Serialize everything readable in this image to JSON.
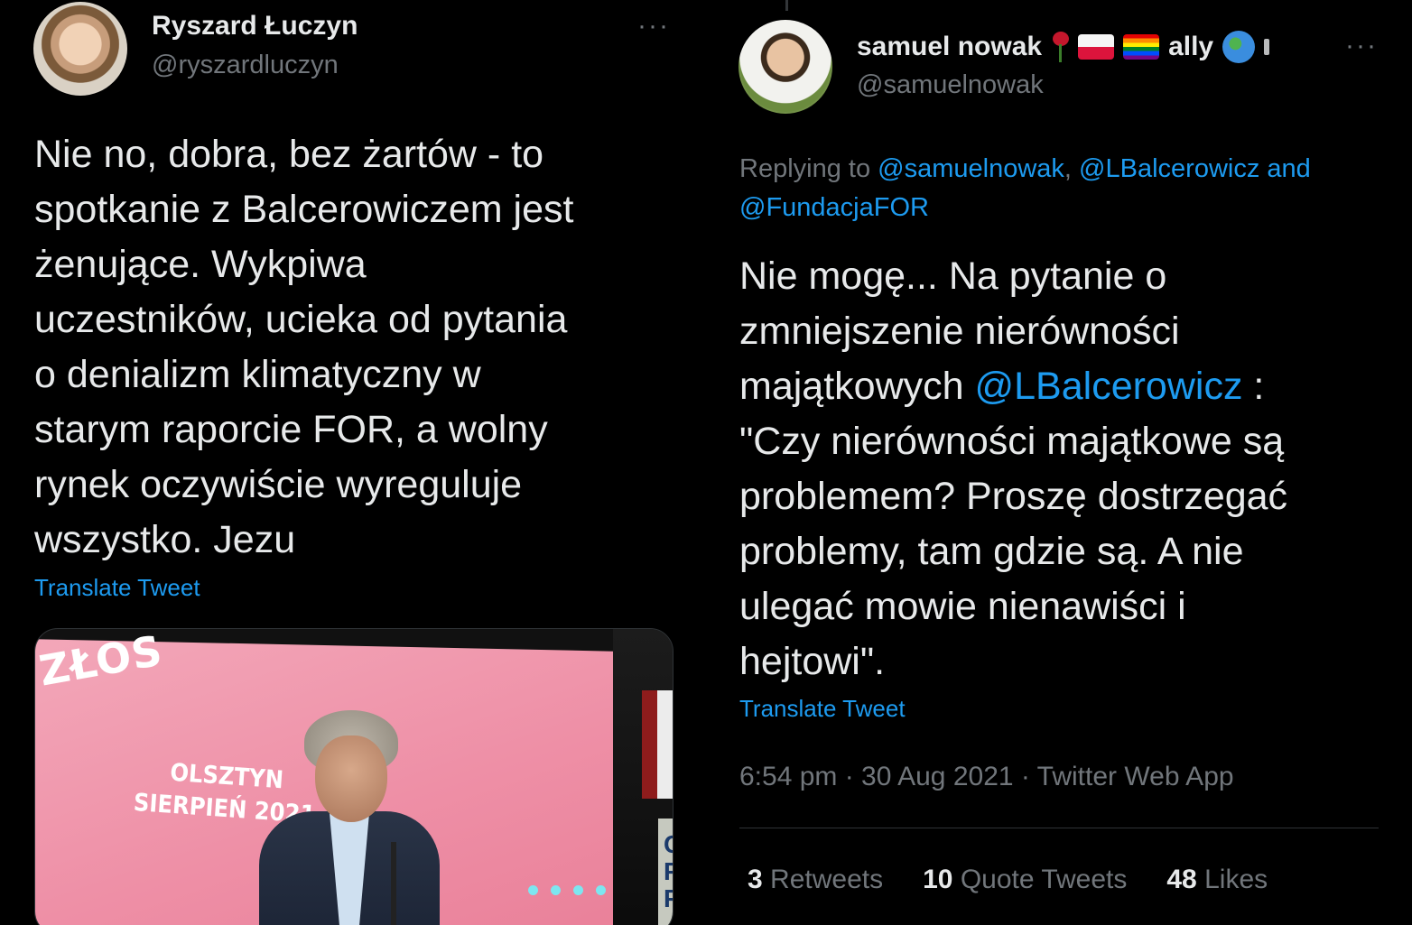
{
  "colors": {
    "background": "#000000",
    "text_primary": "#e7e9ea",
    "text_secondary": "#71767b",
    "link": "#1d9bf0",
    "divider": "#2f3336"
  },
  "left_tweet": {
    "author_name": "Ryszard Łuczyn",
    "author_handle": "@ryszardluczyn",
    "more_icon": "more-dots-icon",
    "more_label": "···",
    "text": "Nie no, dobra, bez żartów - to\nspotkanie z Balcerowiczem jest\nżenujące. Wykpiwa\nuczestników, ucieka od pytania\no denializm klimatyczny w\nstarym raporcie FOR, a wolny\nrynek oczywiście wyreguluje\nwszystko. Jezu",
    "translate_label": "Translate Tweet",
    "media": {
      "logo_text": "ZŁOS",
      "event_line1": "OLSZTYN",
      "event_line2": "SIERPIEŃ 2021",
      "sign_text": "CA\nPO\nPRZY"
    }
  },
  "right_tweet": {
    "author_name": "samuel nowak",
    "name_suffix": "ally",
    "name_emojis": [
      "rose-emoji",
      "poland-flag-emoji",
      "rainbow-flag-emoji",
      "globe-emoji"
    ],
    "author_handle": "@samuelnowak",
    "more_icon": "more-dots-icon",
    "more_label": "···",
    "replying_prefix": "Replying to ",
    "replying_mentions": [
      "@samuelnowak",
      "@LBalcerowicz"
    ],
    "replying_separator": ", ",
    "replying_and": " and ",
    "replying_last": "@FundacjaFOR",
    "text_before_mention": "Nie mogę... Na pytanie o\nzmniejszenie nierówności\nmajątkowych ",
    "text_mention": "@LBalcerowicz",
    "text_after_mention": " :\n\"Czy nierówności majątkowe są\nproblemem? Proszę dostrzegać\nproblemy, tam gdzie są. A nie\nulegać mowie nienawiści i\nhejtowi\".",
    "translate_label": "Translate Tweet",
    "timestamp": "6:54 pm · 30 Aug 2021 · Twitter Web App",
    "stats": [
      {
        "count": "3",
        "label": "Retweets"
      },
      {
        "count": "10",
        "label": "Quote Tweets"
      },
      {
        "count": "48",
        "label": "Likes"
      }
    ]
  }
}
